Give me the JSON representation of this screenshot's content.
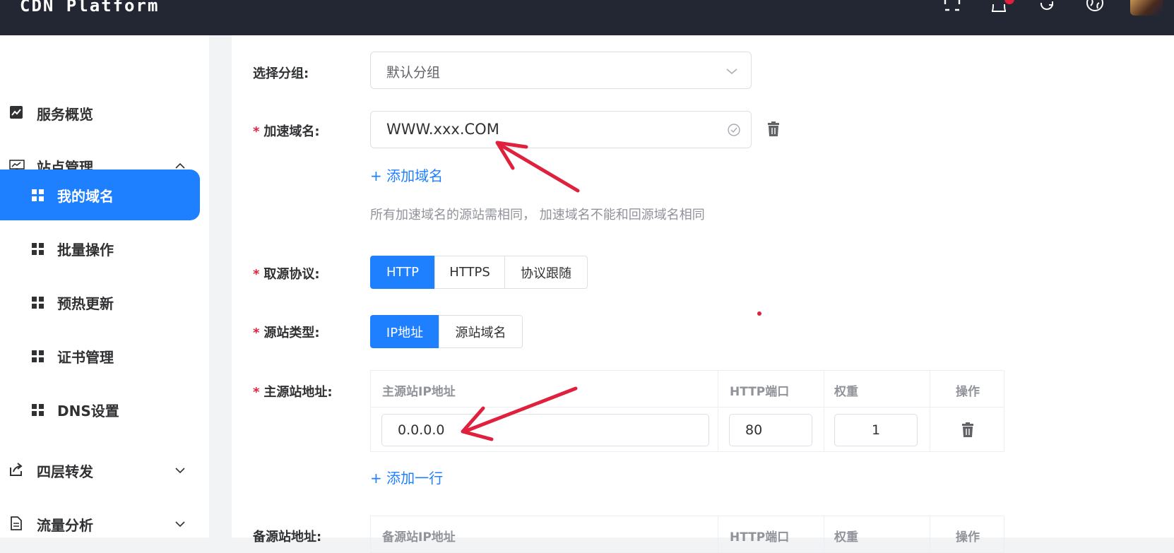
{
  "header": {
    "brand": "CDN Platform",
    "icons": [
      "fullscreen-icon",
      "bell-icon",
      "refresh-icon",
      "globe-icon",
      "avatar"
    ]
  },
  "sidebar": {
    "items": [
      {
        "label": "服务概览",
        "icon": "chart-icon"
      },
      {
        "label": "站点管理",
        "icon": "presentation-icon",
        "expanded": true
      },
      {
        "label": "我的域名",
        "icon": "grid-icon",
        "active": true
      },
      {
        "label": "批量操作",
        "icon": "grid-icon"
      },
      {
        "label": "预热更新",
        "icon": "grid-icon"
      },
      {
        "label": "证书管理",
        "icon": "grid-icon"
      },
      {
        "label": "DNS设置",
        "icon": "grid-icon"
      },
      {
        "label": "四层转发",
        "icon": "share-icon",
        "expanded": false
      },
      {
        "label": "流量分析",
        "icon": "document-icon",
        "expanded": false
      }
    ]
  },
  "form": {
    "group": {
      "label": "选择分组:",
      "value": "默认分组"
    },
    "domain": {
      "label": "加速域名:",
      "value": "WWW.xxx.COM",
      "add": "+ 添加域名",
      "hint": "所有加速域名的源站需相同， 加速域名不能和回源域名相同"
    },
    "protocol": {
      "label": "取源协议:",
      "options": [
        "HTTP",
        "HTTPS",
        "协议跟随"
      ],
      "selected": "HTTP"
    },
    "origin_type": {
      "label": "源站类型:",
      "options": [
        "IP地址",
        "源站域名"
      ],
      "selected": "IP地址"
    },
    "primary": {
      "label": "主源站地址:",
      "columns": [
        "主源站IP地址",
        "HTTP端口",
        "权重",
        "操作"
      ],
      "row": {
        "ip": "0.0.0.0",
        "port": "80",
        "weight": "1"
      },
      "add": "+ 添加一行"
    },
    "backup": {
      "label": "备源站地址:",
      "columns": [
        "备源站IP地址",
        "HTTP端口",
        "权重",
        "操作"
      ]
    }
  },
  "colors": {
    "accent": "#1e80ff",
    "topbar": "#232733",
    "required": "#e0213d",
    "annotation": "#e0213d"
  }
}
